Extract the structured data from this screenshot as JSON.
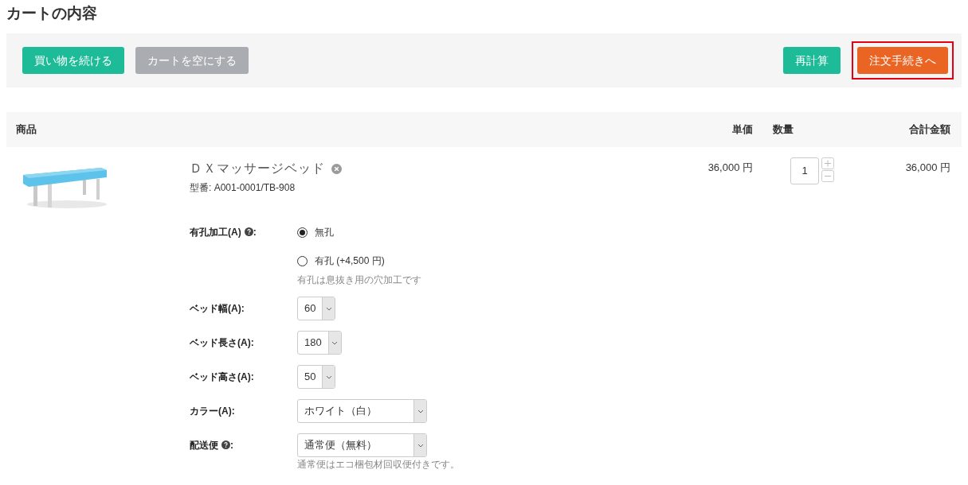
{
  "title": "カートの内容",
  "toolbar": {
    "left": [
      {
        "label": "買い物を続ける",
        "kind": "primary",
        "disabled": false,
        "highlighted": false
      },
      {
        "label": "カートを空にする",
        "kind": "primary",
        "disabled": true,
        "highlighted": false
      }
    ],
    "right": [
      {
        "label": "再計算",
        "kind": "primary",
        "disabled": false,
        "highlighted": false
      },
      {
        "label": "注文手続きへ",
        "kind": "checkout",
        "disabled": false,
        "highlighted": true
      }
    ]
  },
  "table": {
    "columns": [
      "商品",
      "単価",
      "数量",
      "合計金額"
    ],
    "rows": [
      {
        "name": "ＤＸマッサージベッド",
        "model": "型番: A001-0001/TB-908",
        "unit_price": "36,000 円",
        "quantity": "1",
        "total": "36,000 円",
        "options": [
          {
            "kind": "radio",
            "label": "有孔加工(A)",
            "help": true,
            "suffix": ":",
            "choices": [
              {
                "label": "無孔",
                "selected": true
              },
              {
                "label": "有孔 (+4,500 円)",
                "selected": false
              }
            ],
            "note": "有孔は息抜き用の穴加工です"
          },
          {
            "kind": "select",
            "label": "ベッド幅(A):",
            "help": false,
            "value": "60"
          },
          {
            "kind": "select",
            "label": "ベッド長さ(A):",
            "help": false,
            "value": "180"
          },
          {
            "kind": "select",
            "label": "ベッド高さ(A):",
            "help": false,
            "value": "50"
          },
          {
            "kind": "select",
            "label": "カラー(A):",
            "help": false,
            "value": "ホワイト（白）"
          },
          {
            "kind": "select",
            "label": "配送便",
            "help": true,
            "suffix": ":",
            "value": "通常便（無料）",
            "note": "通常便はエコ梱包材回収便付きです。"
          }
        ]
      }
    ]
  }
}
